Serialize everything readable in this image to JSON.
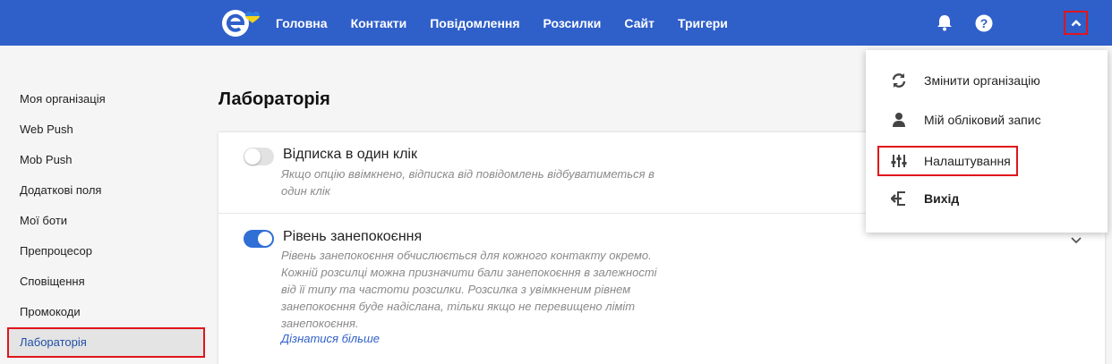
{
  "header": {
    "nav": [
      "Головна",
      "Контакти",
      "Повідомлення",
      "Розсилки",
      "Сайт",
      "Тригери"
    ],
    "icons": [
      "logo-icon",
      "bell-icon",
      "help-icon",
      "chevron-up-icon"
    ]
  },
  "sidebar": {
    "items": [
      {
        "label": "Моя організація"
      },
      {
        "label": "Web Push"
      },
      {
        "label": "Mob Push"
      },
      {
        "label": "Додаткові поля"
      },
      {
        "label": "Мої боти"
      },
      {
        "label": "Препроцесор"
      },
      {
        "label": "Сповіщення"
      },
      {
        "label": "Промокоди"
      },
      {
        "label": "Лабораторія",
        "active": true
      }
    ]
  },
  "main": {
    "title": "Лабораторія",
    "options": [
      {
        "title": "Відписка в один клік",
        "enabled": false,
        "description_lines": [
          "Якщо опцію ввімкнено, відписка від повідомлень відбуватиметься в",
          "один клік"
        ]
      },
      {
        "title": "Рівень занепокоєння",
        "enabled": true,
        "description_lines": [
          "Рівень занепокоєння обчислюється для кожного контакту окремо.",
          "Кожній розсилці можна призначити бали занепокоєння в залежності",
          "від її типу та частоти розсилки. Розсилка з увімкненим рівнем",
          "занепокоєння буде надіслана, тільки якщо не перевищено ліміт",
          "занепокоєння."
        ],
        "link": "Дізнатися більше"
      }
    ]
  },
  "menu": {
    "items": [
      {
        "label": "Змінити організацію",
        "icon": "refresh-icon"
      },
      {
        "label": "Мій обліковий запис",
        "icon": "user-icon"
      },
      {
        "label": "Налаштування",
        "icon": "sliders-icon",
        "highlighted": true
      },
      {
        "label": "Вихід",
        "icon": "logout-icon"
      }
    ]
  },
  "colors": {
    "header_bg": "#2f5fc9",
    "accent": "#2f6fd6",
    "highlight_border": "#e0151b"
  }
}
